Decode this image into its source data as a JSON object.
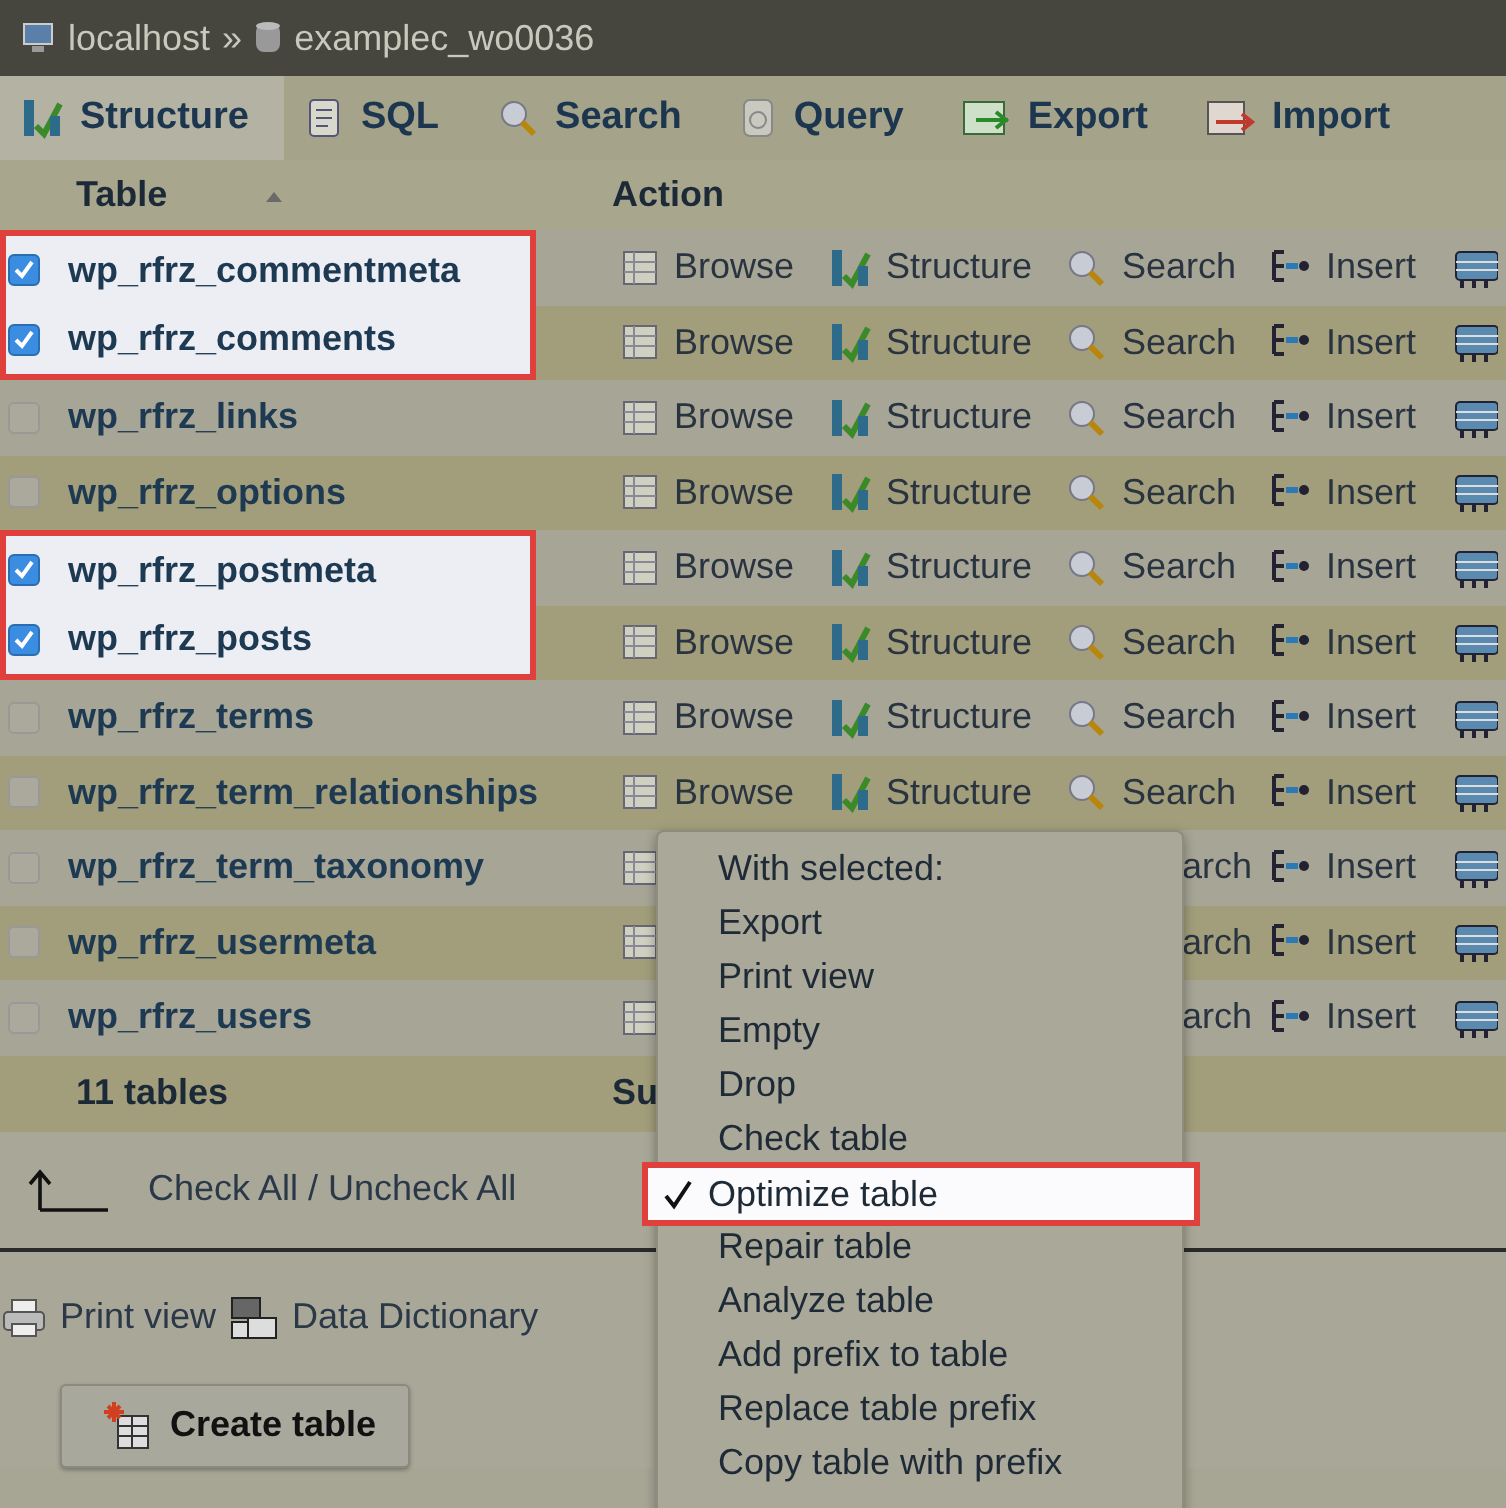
{
  "breadcrumb": {
    "server": "localhost",
    "separator": "»",
    "database": "examplec_wo0036"
  },
  "tabs": [
    {
      "label": "Structure",
      "kind": "structure",
      "selected": true
    },
    {
      "label": "SQL",
      "kind": "sql",
      "selected": false
    },
    {
      "label": "Search",
      "kind": "search",
      "selected": false
    },
    {
      "label": "Query",
      "kind": "query",
      "selected": false
    },
    {
      "label": "Export",
      "kind": "export",
      "selected": false
    },
    {
      "label": "Import",
      "kind": "import",
      "selected": false
    }
  ],
  "table": {
    "columns": [
      {
        "label": "Table",
        "sorted": true
      },
      {
        "label": "Action",
        "sorted": false
      }
    ],
    "rows": [
      {
        "name": "wp_rfrz_commentmeta",
        "checked": true,
        "actions": [
          {
            "kind": "browse",
            "label": "Browse"
          },
          {
            "kind": "structure",
            "label": "Structure"
          },
          {
            "kind": "search",
            "label": "Search"
          },
          {
            "kind": "insert",
            "label": "Insert"
          },
          {
            "kind": "more"
          }
        ]
      },
      {
        "name": "wp_rfrz_comments",
        "checked": true,
        "actions": [
          {
            "kind": "browse",
            "label": "Browse"
          },
          {
            "kind": "structure",
            "label": "Structure"
          },
          {
            "kind": "search",
            "label": "Search"
          },
          {
            "kind": "insert",
            "label": "Insert"
          },
          {
            "kind": "more"
          }
        ]
      },
      {
        "name": "wp_rfrz_links",
        "checked": false,
        "actions": [
          {
            "kind": "browse",
            "label": "Browse"
          },
          {
            "kind": "structure",
            "label": "Structure"
          },
          {
            "kind": "search",
            "label": "Search"
          },
          {
            "kind": "insert",
            "label": "Insert"
          },
          {
            "kind": "more"
          }
        ]
      },
      {
        "name": "wp_rfrz_options",
        "checked": false,
        "actions": [
          {
            "kind": "browse",
            "label": "Browse"
          },
          {
            "kind": "structure",
            "label": "Structure"
          },
          {
            "kind": "search",
            "label": "Search"
          },
          {
            "kind": "insert",
            "label": "Insert"
          },
          {
            "kind": "more"
          }
        ]
      },
      {
        "name": "wp_rfrz_postmeta",
        "checked": true,
        "actions": [
          {
            "kind": "browse",
            "label": "Browse"
          },
          {
            "kind": "structure",
            "label": "Structure"
          },
          {
            "kind": "search",
            "label": "Search"
          },
          {
            "kind": "insert",
            "label": "Insert"
          },
          {
            "kind": "more"
          }
        ]
      },
      {
        "name": "wp_rfrz_posts",
        "checked": true,
        "actions": [
          {
            "kind": "browse",
            "label": "Browse"
          },
          {
            "kind": "structure",
            "label": "Structure"
          },
          {
            "kind": "search",
            "label": "Search"
          },
          {
            "kind": "insert",
            "label": "Insert"
          },
          {
            "kind": "more"
          }
        ]
      },
      {
        "name": "wp_rfrz_terms",
        "checked": false,
        "actions": [
          {
            "kind": "browse",
            "label": "Browse"
          },
          {
            "kind": "structure",
            "label": "Structure"
          },
          {
            "kind": "search",
            "label": "Search"
          },
          {
            "kind": "insert",
            "label": "Insert"
          },
          {
            "kind": "more"
          }
        ]
      },
      {
        "name": "wp_rfrz_term_relationships",
        "checked": false,
        "actions": [
          {
            "kind": "browse",
            "label": "Browse"
          },
          {
            "kind": "structure",
            "label": "Structure"
          },
          {
            "kind": "search",
            "label": "Search"
          },
          {
            "kind": "insert",
            "label": "Insert"
          },
          {
            "kind": "more"
          }
        ]
      },
      {
        "name": "wp_rfrz_term_taxonomy",
        "checked": false,
        "actions": [
          {
            "kind": "browse"
          },
          {
            "kind": "search",
            "label": "arch",
            "partial": true
          },
          {
            "kind": "insert",
            "label": "Insert"
          },
          {
            "kind": "more"
          }
        ]
      },
      {
        "name": "wp_rfrz_usermeta",
        "checked": false,
        "actions": [
          {
            "kind": "browse"
          },
          {
            "kind": "search",
            "label": "arch",
            "partial": true
          },
          {
            "kind": "insert",
            "label": "Insert"
          },
          {
            "kind": "more"
          }
        ]
      },
      {
        "name": "wp_rfrz_users",
        "checked": false,
        "actions": [
          {
            "kind": "browse"
          },
          {
            "kind": "search",
            "label": "arch",
            "partial": true
          },
          {
            "kind": "insert",
            "label": "Insert"
          },
          {
            "kind": "more"
          }
        ]
      }
    ],
    "footer": {
      "count": "11 tables",
      "column_2": "Su"
    }
  },
  "menu": {
    "label": "With selected:",
    "items": [
      {
        "label": "Export",
        "selected": false
      },
      {
        "label": "Print view",
        "selected": false
      },
      {
        "label": "Empty",
        "selected": false
      },
      {
        "label": "Drop",
        "selected": false
      },
      {
        "label": "Check table",
        "selected": false
      },
      {
        "label": "Optimize table",
        "selected": true
      },
      {
        "label": "Repair table",
        "selected": false
      },
      {
        "label": "Analyze table",
        "selected": false
      },
      {
        "label": "Add prefix to table",
        "selected": false
      },
      {
        "label": "Replace table prefix",
        "selected": false
      },
      {
        "label": "Copy table with prefix",
        "selected": false
      }
    ]
  },
  "check_all": "Check All / Uncheck All",
  "links": [
    {
      "kind": "print",
      "label": "Print view"
    },
    {
      "kind": "dictionary",
      "label": "Data Dictionary"
    }
  ],
  "create_button": "Create table"
}
